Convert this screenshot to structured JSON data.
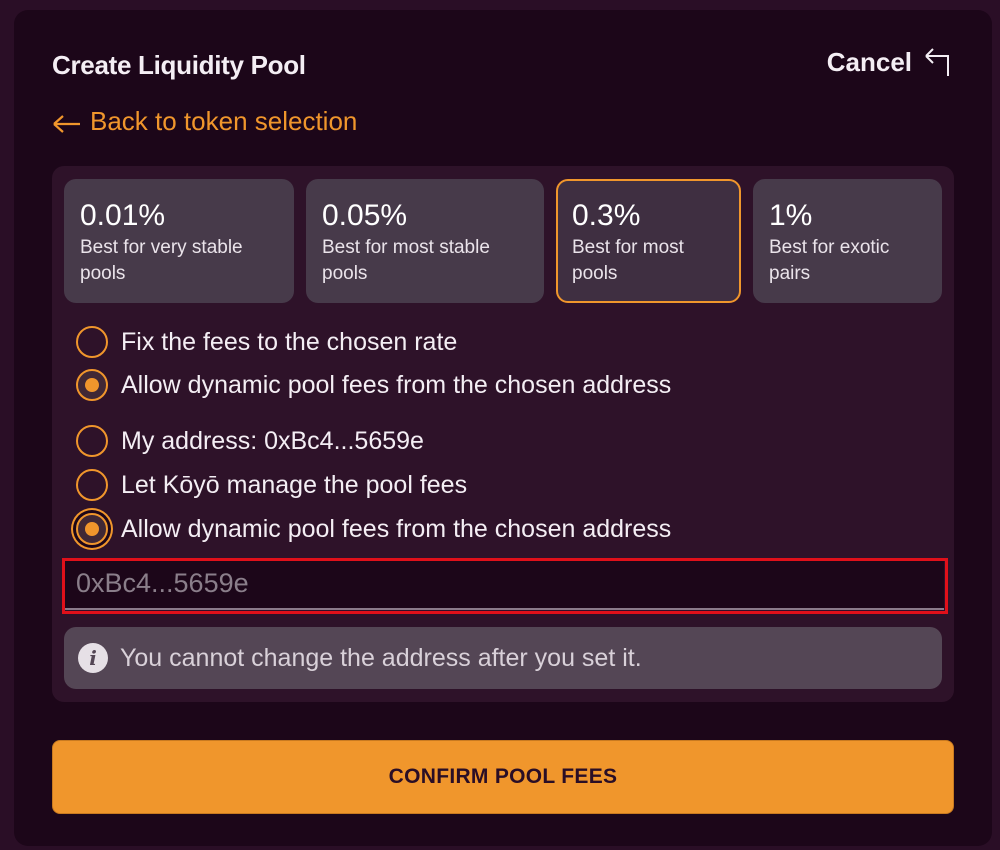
{
  "header": {
    "title": "Create Liquidity Pool",
    "cancel_label": "Cancel",
    "back_label": "Back to token selection"
  },
  "fee_tiers": [
    {
      "value": "0.01%",
      "description": "Best for very stable pools",
      "selected": false
    },
    {
      "value": "0.05%",
      "description": "Best for most stable pools",
      "selected": false
    },
    {
      "value": "0.3%",
      "description": "Best for most pools",
      "selected": true
    },
    {
      "value": "1%",
      "description": "Best for exotic pairs",
      "selected": false
    }
  ],
  "fee_mode_options": [
    {
      "label": "Fix the fees to the chosen rate",
      "checked": false
    },
    {
      "label": "Allow dynamic pool fees from the chosen address",
      "checked": true
    }
  ],
  "address_options": [
    {
      "label": "My address: 0xBc4...5659e",
      "checked": false
    },
    {
      "label": "Let Kōyō manage the pool fees",
      "checked": false
    },
    {
      "label": "Allow dynamic pool fees from the chosen address",
      "checked": true
    }
  ],
  "address_input": {
    "value": "0xBc4...5659e"
  },
  "notice": {
    "text": "You cannot change the address after you set it.",
    "icon": "info-icon"
  },
  "confirm_label": "CONFIRM POOL FEES",
  "colors": {
    "accent": "#f0962c",
    "background": "#1c0619",
    "highlight": "#e0101a"
  }
}
